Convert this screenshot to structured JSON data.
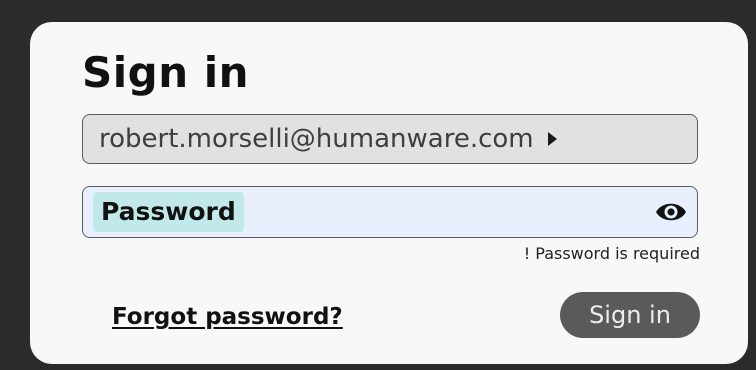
{
  "title": "Sign in",
  "email": {
    "value": "robert.morselli@humanware.com",
    "icon": "caret-right-icon"
  },
  "password": {
    "label": "Password",
    "toggle_icon": "eye-icon",
    "error": "! Password is required"
  },
  "forgot_password": "Forgot password?",
  "submit_label": "Sign in",
  "colors": {
    "background": "#2b2b2b",
    "card": "#f8f8f8",
    "email_field": "#e1e1e1",
    "password_field": "#e8f0fe",
    "password_label_highlight": "#c1e9ea",
    "button": "#5a5a5a"
  }
}
